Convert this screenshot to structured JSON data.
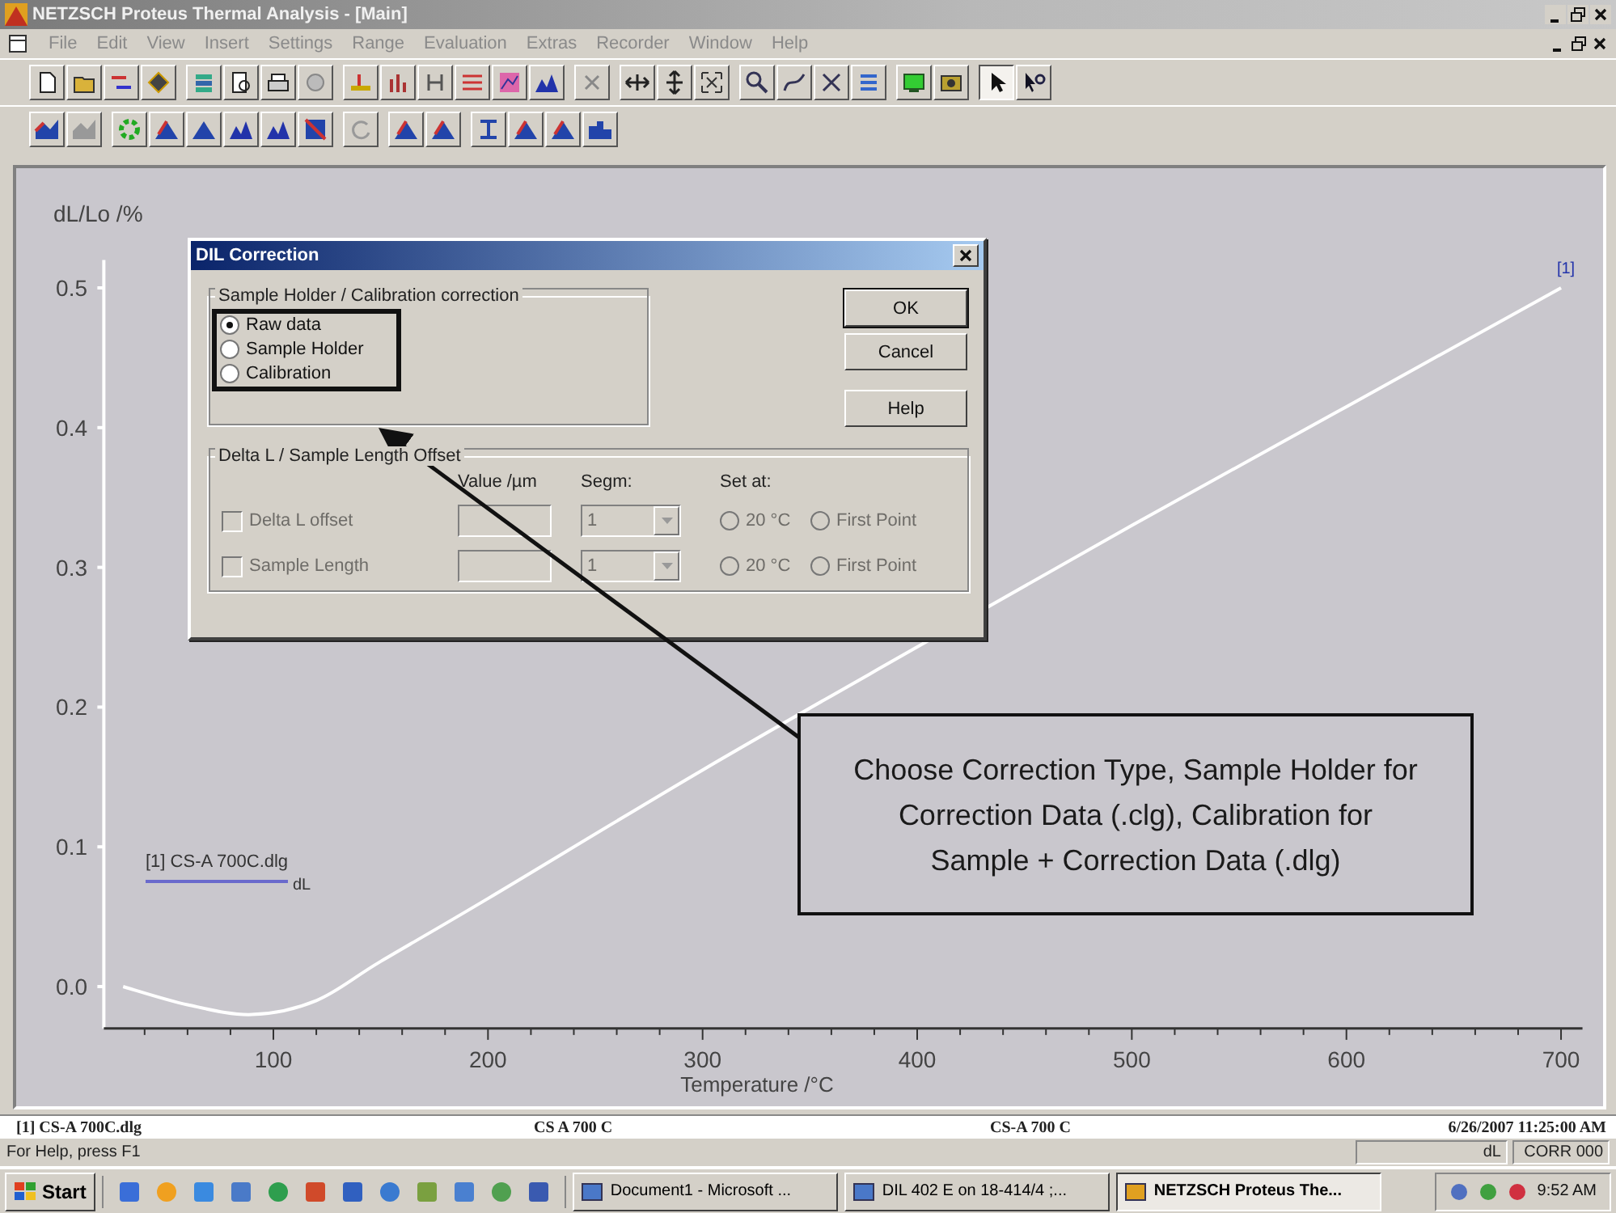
{
  "window": {
    "title": "NETZSCH Proteus Thermal Analysis - [Main]"
  },
  "menu": [
    "File",
    "Edit",
    "View",
    "Insert",
    "Settings",
    "Range",
    "Evaluation",
    "Extras",
    "Recorder",
    "Window",
    "Help"
  ],
  "pointer_tool": {
    "selected": true
  },
  "chart": {
    "series_tag": "[1]",
    "legend": {
      "file": "[1] CS-A 700C.dlg"
    },
    "chart_data": {
      "type": "line",
      "xlabel": "Temperature /°C",
      "ylabel": "dL/Lo /%",
      "x": [
        30,
        60,
        90,
        120,
        150,
        200,
        300,
        400,
        500,
        600,
        700
      ],
      "series": [
        {
          "name": "dL",
          "color": "#ffffff",
          "values": [
            0.0,
            -0.013,
            -0.02,
            -0.01,
            0.018,
            0.063,
            0.155,
            0.243,
            0.33,
            0.415,
            0.5
          ]
        }
      ],
      "xlim": [
        21,
        710
      ],
      "ylim": [
        -0.03,
        0.52
      ],
      "xticks": [
        100,
        200,
        300,
        400,
        500,
        600,
        700
      ],
      "yticks": [
        {
          "value": 0,
          "label": "0.0"
        },
        {
          "value": 0.1,
          "label": "0.1"
        },
        {
          "value": 0.2,
          "label": "0.2"
        },
        {
          "value": 0.3,
          "label": "0.3"
        },
        {
          "value": 0.4,
          "label": "0.4"
        },
        {
          "value": 0.5,
          "label": "0.5"
        }
      ]
    }
  },
  "dialog": {
    "title": "DIL Correction",
    "correction_group": {
      "title": "Sample Holder / Calibration correction",
      "options": [
        {
          "label": "Raw data",
          "selected": true
        },
        {
          "label": "Sample Holder",
          "selected": false
        },
        {
          "label": "Calibration",
          "selected": false
        }
      ]
    },
    "buttons": [
      "OK",
      "Cancel",
      "Help"
    ],
    "offset_group": {
      "title": "Delta L / Sample Length Offset",
      "columns": [
        "Value /µm",
        "Segm:",
        "Set at:"
      ],
      "rows": [
        {
          "label": "Delta L offset",
          "checked": false,
          "disabled": true,
          "segment": "1",
          "set_at": [
            {
              "label": "20 °C",
              "selected": false
            },
            {
              "label": "First Point",
              "selected": false
            }
          ]
        },
        {
          "label": "Sample Length",
          "checked": false,
          "disabled": true,
          "segment": "1",
          "set_at": [
            {
              "label": "20 °C",
              "selected": false
            },
            {
              "label": "First Point",
              "selected": false
            }
          ]
        }
      ]
    }
  },
  "annotation": "Choose Correction Type, Sample Holder for Correction Data (.clg), Calibration for Sample + Correction Data (.dlg)",
  "chart_status": [
    "[1] CS-A 700C.dlg",
    "CS A 700 C",
    "CS-A 700 C",
    "6/26/2007 11:25:00 AM"
  ],
  "status_bar": {
    "help": "For Help, press F1",
    "panes": [
      "dL",
      "CORR 000"
    ]
  },
  "taskbar": {
    "start": "Start",
    "tasks": [
      {
        "label": "Document1 - Microsoft ...",
        "selected": false
      },
      {
        "label": "DIL 402 E on 18-414/4 ;...",
        "selected": false
      },
      {
        "label": "NETZSCH Proteus The...",
        "selected": true
      }
    ],
    "clock": "9:52 AM"
  }
}
